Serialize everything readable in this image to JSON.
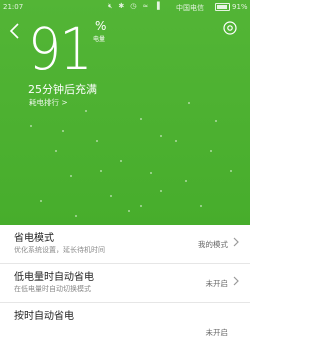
{
  "status_bar": {
    "time": "21:07",
    "icons": [
      "mute-icon",
      "bluetooth-icon",
      "alarm-icon",
      "wifi-icon",
      "signal-icon"
    ],
    "carrier": "中国电信",
    "battery_text": "91%",
    "battery_level": 0.91
  },
  "battery": {
    "level": "91",
    "percent_sign": "%",
    "level_label": "电量",
    "time_to_full": "25分钟后充满",
    "ranking_link": "耗电排行 >"
  },
  "colors": {
    "hero_green": "#4cb031",
    "text_white": "#ffffff"
  },
  "settings": [
    {
      "title": "省电模式",
      "desc": "优化系统设置，延长待机时间",
      "value": "我的模式"
    },
    {
      "title": "低电量时自动省电",
      "desc": "在低电量时自动切换模式",
      "value": "未开启"
    },
    {
      "title": "按时自动省电",
      "desc": "",
      "value": "未开启"
    }
  ]
}
